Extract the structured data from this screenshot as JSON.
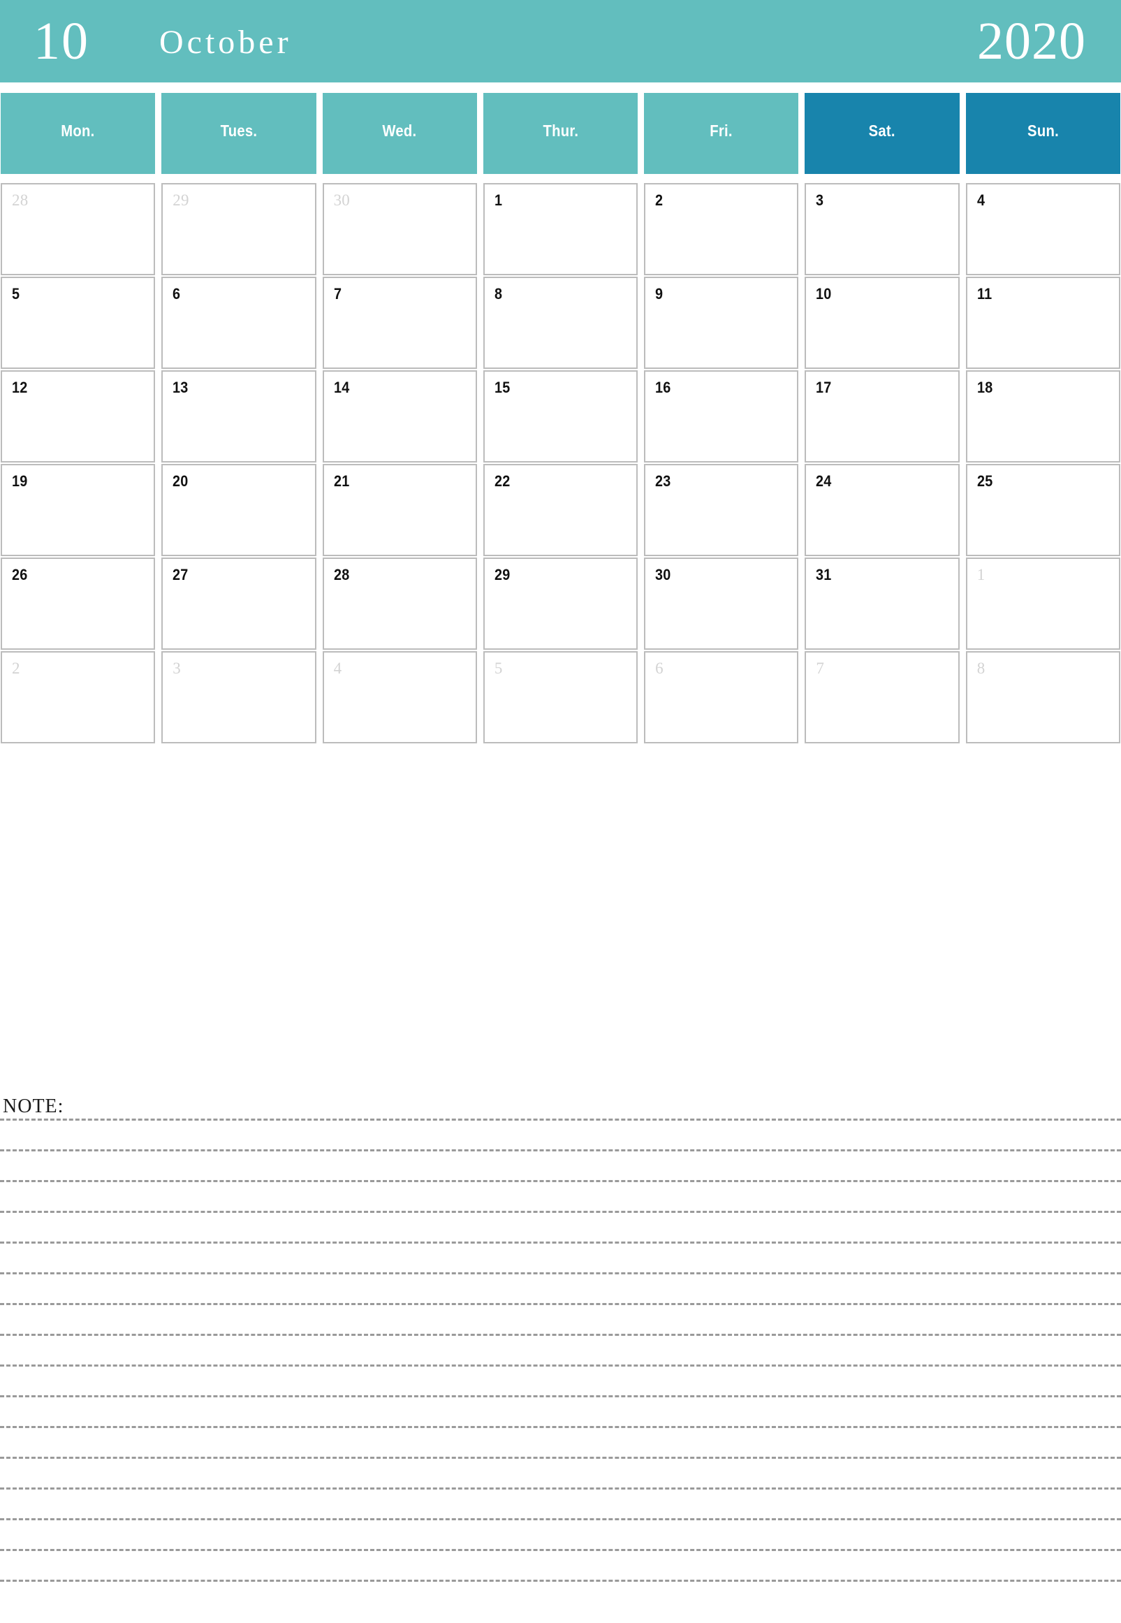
{
  "header": {
    "month_number": "10",
    "month_name": "October",
    "year": "2020",
    "background_color": "#62bebe",
    "text_color": "#ffffff"
  },
  "weekdays": [
    {
      "label": "Mon.",
      "weekend": false,
      "color": "#62bebe"
    },
    {
      "label": "Tues.",
      "weekend": false,
      "color": "#62bebe"
    },
    {
      "label": "Wed.",
      "weekend": false,
      "color": "#62bebe"
    },
    {
      "label": "Thur.",
      "weekend": false,
      "color": "#62bebe"
    },
    {
      "label": "Fri.",
      "weekend": false,
      "color": "#62bebe"
    },
    {
      "label": "Sat.",
      "weekend": true,
      "color": "#1884ac"
    },
    {
      "label": "Sun.",
      "weekend": true,
      "color": "#1884ac"
    }
  ],
  "calendar": {
    "grid_border_color": "#bcbcbc",
    "current_month_text_color": "#111111",
    "adjacent_month_text_color": "#d3d3d3",
    "weeks": [
      [
        {
          "day": "28",
          "current_month": false
        },
        {
          "day": "29",
          "current_month": false
        },
        {
          "day": "30",
          "current_month": false
        },
        {
          "day": "1",
          "current_month": true
        },
        {
          "day": "2",
          "current_month": true
        },
        {
          "day": "3",
          "current_month": true
        },
        {
          "day": "4",
          "current_month": true
        }
      ],
      [
        {
          "day": "5",
          "current_month": true
        },
        {
          "day": "6",
          "current_month": true
        },
        {
          "day": "7",
          "current_month": true
        },
        {
          "day": "8",
          "current_month": true
        },
        {
          "day": "9",
          "current_month": true
        },
        {
          "day": "10",
          "current_month": true
        },
        {
          "day": "11",
          "current_month": true
        }
      ],
      [
        {
          "day": "12",
          "current_month": true
        },
        {
          "day": "13",
          "current_month": true
        },
        {
          "day": "14",
          "current_month": true
        },
        {
          "day": "15",
          "current_month": true
        },
        {
          "day": "16",
          "current_month": true
        },
        {
          "day": "17",
          "current_month": true
        },
        {
          "day": "18",
          "current_month": true
        }
      ],
      [
        {
          "day": "19",
          "current_month": true
        },
        {
          "day": "20",
          "current_month": true
        },
        {
          "day": "21",
          "current_month": true
        },
        {
          "day": "22",
          "current_month": true
        },
        {
          "day": "23",
          "current_month": true
        },
        {
          "day": "24",
          "current_month": true
        },
        {
          "day": "25",
          "current_month": true
        }
      ],
      [
        {
          "day": "26",
          "current_month": true
        },
        {
          "day": "27",
          "current_month": true
        },
        {
          "day": "28",
          "current_month": true
        },
        {
          "day": "29",
          "current_month": true
        },
        {
          "day": "30",
          "current_month": true
        },
        {
          "day": "31",
          "current_month": true
        },
        {
          "day": "1",
          "current_month": false
        }
      ],
      [
        {
          "day": "2",
          "current_month": false
        },
        {
          "day": "3",
          "current_month": false
        },
        {
          "day": "4",
          "current_month": false
        },
        {
          "day": "5",
          "current_month": false
        },
        {
          "day": "6",
          "current_month": false
        },
        {
          "day": "7",
          "current_month": false
        },
        {
          "day": "8",
          "current_month": false
        }
      ]
    ]
  },
  "note": {
    "label": "NOTE:",
    "line_count": 16,
    "line_color": "#9a9a9a"
  }
}
